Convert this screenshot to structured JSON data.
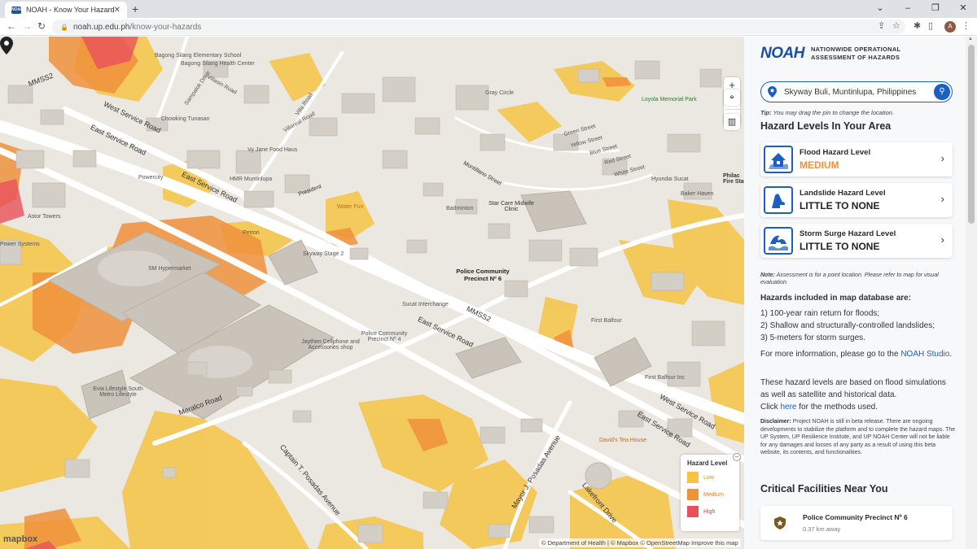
{
  "browser": {
    "tab_title": "NOAH - Know Your Hazards",
    "favicon_text": "NOAH",
    "url_host": "noah.up.edu.ph",
    "url_path": "/know-your-hazards",
    "avatar_letter": "A"
  },
  "map": {
    "area_labels": [
      {
        "text": "Bagong Silang Elementary School"
      },
      {
        "text": "Bagong Silang Health Center"
      },
      {
        "text": "Villasin Road"
      },
      {
        "text": "Sampalok Drive"
      },
      {
        "text": "Villa Road"
      },
      {
        "text": "Chowking Tunasan"
      },
      {
        "text": "Vy Jane Food Haus"
      },
      {
        "text": "Villareal Road"
      },
      {
        "text": "Gray Circle"
      },
      {
        "text": "Loyola Memorial Park"
      },
      {
        "text": "Green Street"
      },
      {
        "text": "Yellow Street"
      },
      {
        "text": "Blue Street"
      },
      {
        "text": "Red Street"
      },
      {
        "text": "White Street"
      },
      {
        "text": "Hyundai Sucat"
      },
      {
        "text": "Baker Haven"
      },
      {
        "text": "Philac Fire Sta"
      },
      {
        "text": "Powercity"
      },
      {
        "text": "Star Care Midwife Clinic"
      },
      {
        "text": "Badminton"
      },
      {
        "text": "Water Fun"
      },
      {
        "text": "Astor Towers"
      },
      {
        "text": "Petron"
      },
      {
        "text": "SM Hypermarket"
      },
      {
        "text": "Skyway Stage 2"
      },
      {
        "text": "Sucat Interchange"
      },
      {
        "text": "Jaythen Cellphone and Accessories shop"
      },
      {
        "text": "Police Community Precinct Nº 4"
      },
      {
        "text": "First Balfour"
      },
      {
        "text": "First Balfour Inc"
      },
      {
        "text": "Evia Lifestyle South Metro Lifestyle"
      },
      {
        "text": "David's Tea House"
      },
      {
        "text": "Power Systems"
      },
      {
        "text": "HMR Muntinlupa"
      }
    ],
    "road_labels": {
      "mmss2_top": "MMSS2",
      "west_service_1": "West Service Road",
      "east_service_1": "East Service Road",
      "mmss2_mid": "MMSS2",
      "east_service_2": "East Service Road",
      "meralco": "Meralco Road",
      "west_service_2": "West Service Road",
      "east_service_3": "East Service Road",
      "capt_posadas": "Captain T. Posadas Avenue",
      "mayor_posadas": "Mayor J. Posadas Avenue",
      "lakefront": "Lakefront Drive",
      "montillano": "Montillano Street",
      "president": "President"
    },
    "highlight_label": "Police Community Precinct Nº 6",
    "controls": {
      "zoom_in": "+",
      "zoom_out": "−",
      "compass": "▲"
    },
    "legend": {
      "title": "Hazard Level",
      "items": [
        {
          "label": "Low",
          "color": "#f6c445"
        },
        {
          "label": "Medium",
          "color": "#f0913c"
        },
        {
          "label": "High",
          "color": "#e8515a"
        }
      ]
    },
    "mapbox": "mapbox",
    "attribution": "© Department of Health | © Mapbox © OpenStreetMap  Improve this map"
  },
  "sidebar": {
    "logo_mark": "NOAH",
    "logo_sub_1": "NATIONWIDE OPERATIONAL",
    "logo_sub_2": "ASSESSMENT OF HAZARDS",
    "search_value": "Skyway Buli, Muntinlupa, Philippines",
    "tip_label": "Tip:",
    "tip_text": " You may drag the pin to change the location.",
    "levels_heading": "Hazard Levels In Your Area",
    "hazards": [
      {
        "name": "Flood Hazard Level",
        "level": "MEDIUM"
      },
      {
        "name": "Landslide Hazard Level",
        "level": "LITTLE TO NONE"
      },
      {
        "name": "Storm Surge Hazard Level",
        "level": "LITTLE TO NONE"
      }
    ],
    "note_label": "Note:",
    "note_text": " Assessment is for a point location. Please refer to map for visual evaluation.",
    "included_heading": "Hazards included in map database are:",
    "included_1": "1) 100-year rain return for floods;",
    "included_2": "2) Shallow and structurally-controlled landslides;",
    "included_3": "3) 5-meters for storm surges.",
    "info_pre": "For more information, please go to the ",
    "info_link": "NOAH Studio",
    "info_post": ".",
    "sim_text": "These hazard levels are based on flood simulations as well as satellite and historical data.",
    "click_pre": "Click ",
    "click_link": "here",
    "click_post": " for the methods used.",
    "disclaimer_label": "Disclaimer:",
    "disclaimer_text": " Project NOAH is still in beta release. There are ongoing developments to stabilize the platform and to complete the hazard maps. The UP System, UP Resilience Institute, and UP NOAH Center will not be liable for any damages and losses of any party as a result of using this beta website, its contents, and functionalities.",
    "facilities_heading": "Critical Facilities Near You",
    "facility_name": "Police Community Precinct Nº 6",
    "facility_distance": "0.37 km away"
  },
  "colors": {
    "accent": "#1b5fc4",
    "low": "#f6c445",
    "medium": "#f0913c",
    "high": "#e8515a"
  }
}
